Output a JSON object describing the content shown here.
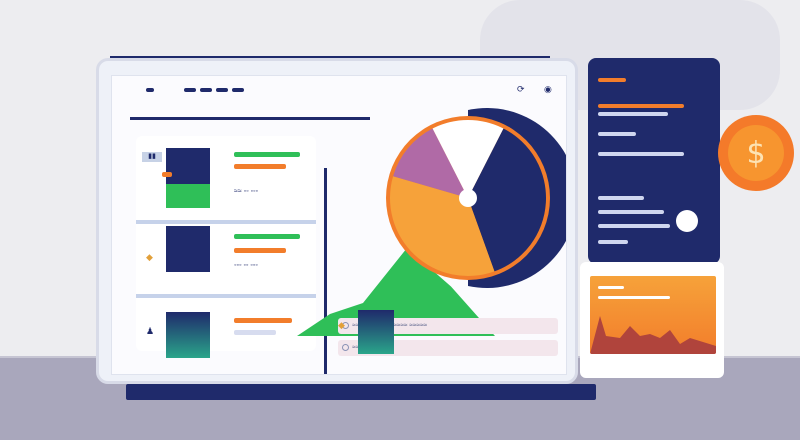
{
  "monitor": {
    "nav": {
      "icons": [
        "refresh-icon",
        "record-icon"
      ],
      "icon_glyphs": [
        "⟳",
        "◉"
      ]
    },
    "rows": [
      {
        "badge": "▮▮",
        "text": "≈≈  ◦◦ ◦◦◦"
      },
      {
        "badge": "",
        "text": "◦◦◦  ◦◦ ◦◦◦"
      },
      {
        "badge": "",
        "text": ""
      }
    ],
    "info_rows": [
      {
        "text": "≈≈≈ ≈≈≈≈ ≈≈≈ ≈≈≈≈ ≈≈≈≈≈"
      },
      {
        "text": "≈≈≈≈≈"
      }
    ],
    "pie": {
      "slices": [
        {
          "name": "navy",
          "value": 37,
          "color": "#1f2a6b"
        },
        {
          "name": "orange",
          "value": 35,
          "color": "#f6a23a"
        },
        {
          "name": "purple",
          "value": 13,
          "color": "#b06aa6"
        },
        {
          "name": "white",
          "value": 15,
          "color": "#ffffff"
        }
      ]
    }
  },
  "side_panel": {
    "accent": "#f27d2b",
    "dark": "#1f2a6b"
  },
  "coin": {
    "symbol": "$"
  },
  "colors": {
    "navy": "#1f2a6b",
    "orange": "#f27d2b",
    "green": "#2fbf58",
    "gold": "#f6a23a"
  }
}
